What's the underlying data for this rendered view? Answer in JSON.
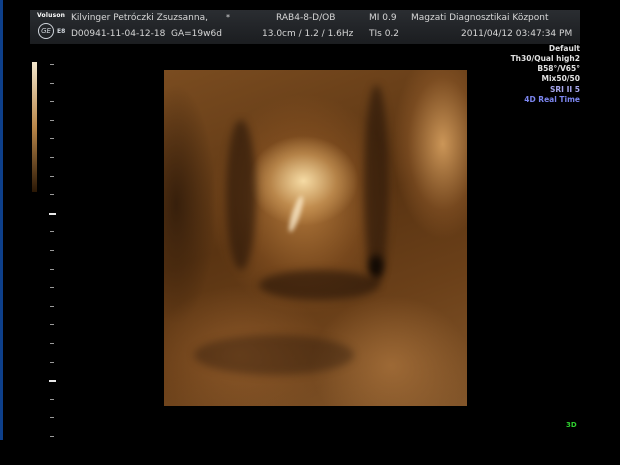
{
  "header": {
    "brand": "Voluson",
    "logo": "GE",
    "edition": "E8",
    "patient_name": "Kilvinger Petróczki Zsuzsanna,",
    "patient_name_marker": "*",
    "patient_id": "D00941-11-04-12-18",
    "gestational_age": "GA=19w6d",
    "probe": "RAB4-8-D/OB",
    "depth_info": "13.0cm / 1.2 / 1.6Hz",
    "mi": "MI  0.9",
    "tis": "TIs  0.2",
    "institution": "Magzati Diagnosztikai Központ",
    "datetime": "2011/04/12  03:47:34 PM"
  },
  "settings": {
    "preset": "Default",
    "quality": "Th30/Qual high2",
    "angles": "B58°/V65°",
    "mix": "Mix50/50",
    "sri": "SRI II 5",
    "mode": "4D Real Time",
    "view_mode": "3D"
  },
  "colors": {
    "background": "#000000",
    "header_band": "#232528",
    "mode_text": "#7c86f0",
    "view_mode_text": "#2fcf2f",
    "render_tone": "#8a5a2a"
  }
}
